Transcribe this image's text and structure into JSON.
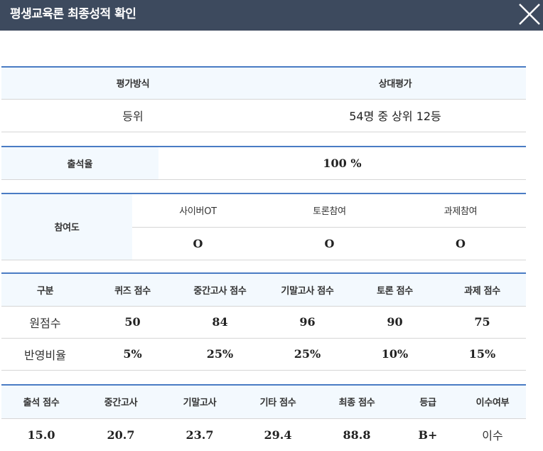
{
  "window": {
    "title": "평생교육론 최종성적 확인",
    "close_icon": "close-icon"
  },
  "evaluation": {
    "method_header": "평가방식",
    "method_value_header": "상대평가",
    "rank_label": "등위",
    "rank_value": "54명 중 상위 12등"
  },
  "attendance": {
    "label": "출석율",
    "value": "100 %"
  },
  "participation": {
    "label": "참여도",
    "columns": [
      "사이버OT",
      "토론참여",
      "과제참여"
    ],
    "values": [
      "O",
      "O",
      "O"
    ]
  },
  "scores": {
    "headers": [
      "구분",
      "퀴즈 점수",
      "중간고사 점수",
      "기말고사 점수",
      "토론 점수",
      "과제 점수"
    ],
    "raw": {
      "label": "원점수",
      "values": [
        "50",
        "84",
        "96",
        "90",
        "75"
      ]
    },
    "ratio": {
      "label": "반영비율",
      "values": [
        "5%",
        "25%",
        "25%",
        "10%",
        "15%"
      ]
    }
  },
  "final": {
    "headers": [
      "출석 점수",
      "중간고사",
      "기말고사",
      "기타 점수",
      "최종 점수",
      "등급",
      "이수여부"
    ],
    "values": [
      "15.0",
      "20.7",
      "23.7",
      "29.4",
      "88.8",
      "B+",
      "이수"
    ]
  },
  "colors": {
    "titlebar": "#3d4a5e",
    "table_border_top": "#4a7cc4",
    "header_bg": "#f3f9fe"
  }
}
